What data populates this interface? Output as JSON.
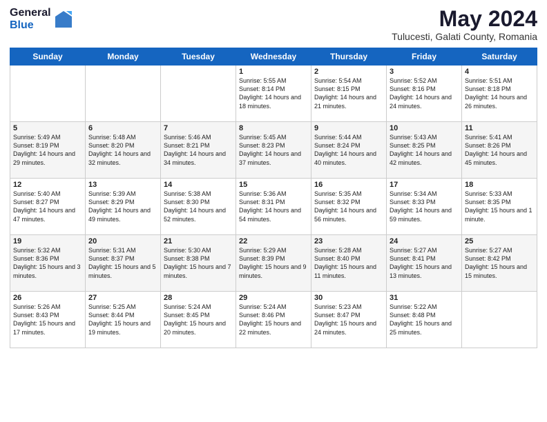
{
  "header": {
    "logo_general": "General",
    "logo_blue": "Blue",
    "title": "May 2024",
    "subtitle": "Tulucesti, Galati County, Romania"
  },
  "days_of_week": [
    "Sunday",
    "Monday",
    "Tuesday",
    "Wednesday",
    "Thursday",
    "Friday",
    "Saturday"
  ],
  "weeks": [
    [
      {
        "day": "",
        "info": ""
      },
      {
        "day": "",
        "info": ""
      },
      {
        "day": "",
        "info": ""
      },
      {
        "day": "1",
        "info": "Sunrise: 5:55 AM\nSunset: 8:14 PM\nDaylight: 14 hours\nand 18 minutes."
      },
      {
        "day": "2",
        "info": "Sunrise: 5:54 AM\nSunset: 8:15 PM\nDaylight: 14 hours\nand 21 minutes."
      },
      {
        "day": "3",
        "info": "Sunrise: 5:52 AM\nSunset: 8:16 PM\nDaylight: 14 hours\nand 24 minutes."
      },
      {
        "day": "4",
        "info": "Sunrise: 5:51 AM\nSunset: 8:18 PM\nDaylight: 14 hours\nand 26 minutes."
      }
    ],
    [
      {
        "day": "5",
        "info": "Sunrise: 5:49 AM\nSunset: 8:19 PM\nDaylight: 14 hours\nand 29 minutes."
      },
      {
        "day": "6",
        "info": "Sunrise: 5:48 AM\nSunset: 8:20 PM\nDaylight: 14 hours\nand 32 minutes."
      },
      {
        "day": "7",
        "info": "Sunrise: 5:46 AM\nSunset: 8:21 PM\nDaylight: 14 hours\nand 34 minutes."
      },
      {
        "day": "8",
        "info": "Sunrise: 5:45 AM\nSunset: 8:23 PM\nDaylight: 14 hours\nand 37 minutes."
      },
      {
        "day": "9",
        "info": "Sunrise: 5:44 AM\nSunset: 8:24 PM\nDaylight: 14 hours\nand 40 minutes."
      },
      {
        "day": "10",
        "info": "Sunrise: 5:43 AM\nSunset: 8:25 PM\nDaylight: 14 hours\nand 42 minutes."
      },
      {
        "day": "11",
        "info": "Sunrise: 5:41 AM\nSunset: 8:26 PM\nDaylight: 14 hours\nand 45 minutes."
      }
    ],
    [
      {
        "day": "12",
        "info": "Sunrise: 5:40 AM\nSunset: 8:27 PM\nDaylight: 14 hours\nand 47 minutes."
      },
      {
        "day": "13",
        "info": "Sunrise: 5:39 AM\nSunset: 8:29 PM\nDaylight: 14 hours\nand 49 minutes."
      },
      {
        "day": "14",
        "info": "Sunrise: 5:38 AM\nSunset: 8:30 PM\nDaylight: 14 hours\nand 52 minutes."
      },
      {
        "day": "15",
        "info": "Sunrise: 5:36 AM\nSunset: 8:31 PM\nDaylight: 14 hours\nand 54 minutes."
      },
      {
        "day": "16",
        "info": "Sunrise: 5:35 AM\nSunset: 8:32 PM\nDaylight: 14 hours\nand 56 minutes."
      },
      {
        "day": "17",
        "info": "Sunrise: 5:34 AM\nSunset: 8:33 PM\nDaylight: 14 hours\nand 59 minutes."
      },
      {
        "day": "18",
        "info": "Sunrise: 5:33 AM\nSunset: 8:35 PM\nDaylight: 15 hours\nand 1 minute."
      }
    ],
    [
      {
        "day": "19",
        "info": "Sunrise: 5:32 AM\nSunset: 8:36 PM\nDaylight: 15 hours\nand 3 minutes."
      },
      {
        "day": "20",
        "info": "Sunrise: 5:31 AM\nSunset: 8:37 PM\nDaylight: 15 hours\nand 5 minutes."
      },
      {
        "day": "21",
        "info": "Sunrise: 5:30 AM\nSunset: 8:38 PM\nDaylight: 15 hours\nand 7 minutes."
      },
      {
        "day": "22",
        "info": "Sunrise: 5:29 AM\nSunset: 8:39 PM\nDaylight: 15 hours\nand 9 minutes."
      },
      {
        "day": "23",
        "info": "Sunrise: 5:28 AM\nSunset: 8:40 PM\nDaylight: 15 hours\nand 11 minutes."
      },
      {
        "day": "24",
        "info": "Sunrise: 5:27 AM\nSunset: 8:41 PM\nDaylight: 15 hours\nand 13 minutes."
      },
      {
        "day": "25",
        "info": "Sunrise: 5:27 AM\nSunset: 8:42 PM\nDaylight: 15 hours\nand 15 minutes."
      }
    ],
    [
      {
        "day": "26",
        "info": "Sunrise: 5:26 AM\nSunset: 8:43 PM\nDaylight: 15 hours\nand 17 minutes."
      },
      {
        "day": "27",
        "info": "Sunrise: 5:25 AM\nSunset: 8:44 PM\nDaylight: 15 hours\nand 19 minutes."
      },
      {
        "day": "28",
        "info": "Sunrise: 5:24 AM\nSunset: 8:45 PM\nDaylight: 15 hours\nand 20 minutes."
      },
      {
        "day": "29",
        "info": "Sunrise: 5:24 AM\nSunset: 8:46 PM\nDaylight: 15 hours\nand 22 minutes."
      },
      {
        "day": "30",
        "info": "Sunrise: 5:23 AM\nSunset: 8:47 PM\nDaylight: 15 hours\nand 24 minutes."
      },
      {
        "day": "31",
        "info": "Sunrise: 5:22 AM\nSunset: 8:48 PM\nDaylight: 15 hours\nand 25 minutes."
      },
      {
        "day": "",
        "info": ""
      }
    ]
  ]
}
